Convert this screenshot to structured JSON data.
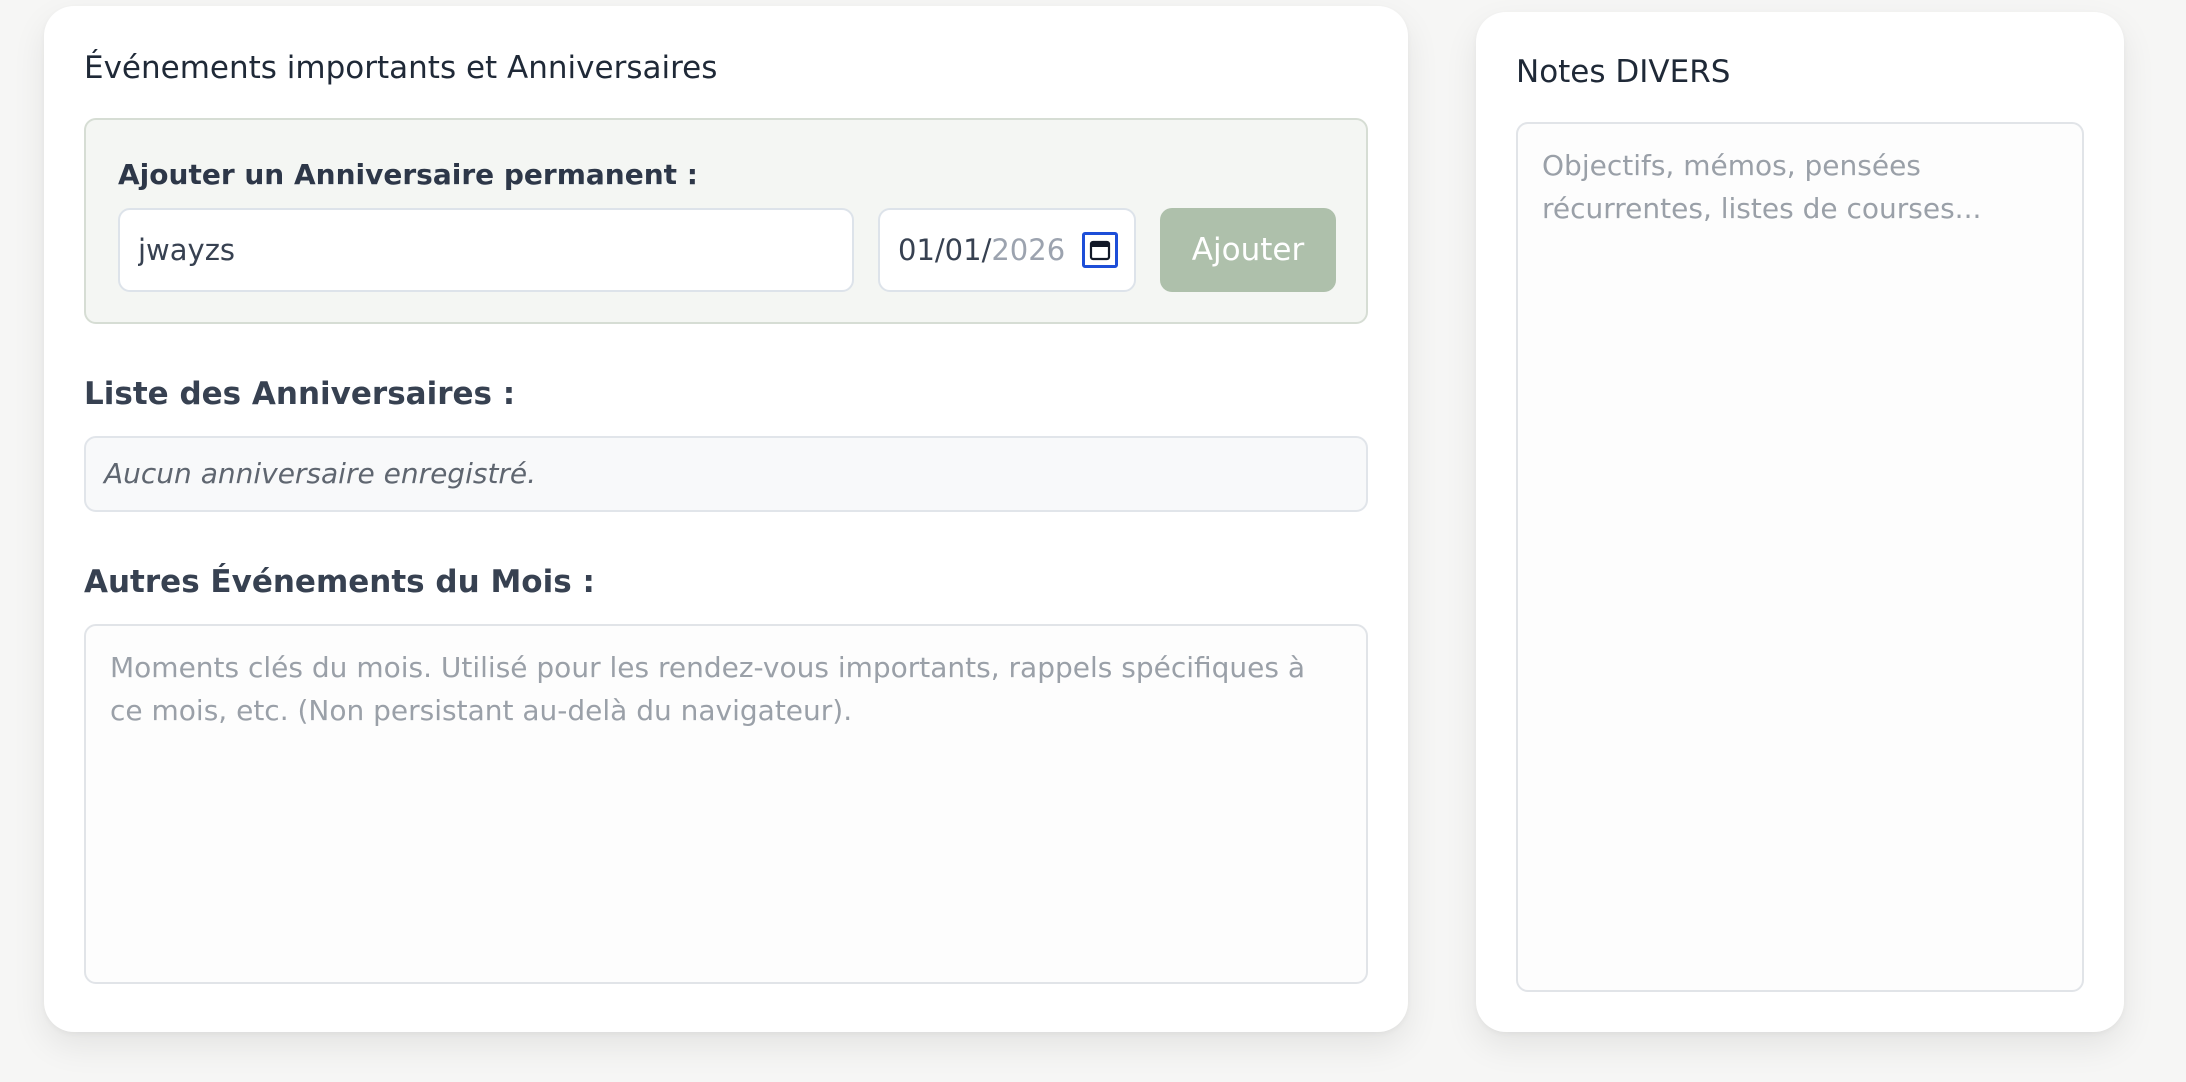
{
  "events_card": {
    "title": "Événements importants et Anniversaires",
    "add_section": {
      "label": "Ajouter un Anniversaire permanent :",
      "name_value": "jwayzs",
      "date_day_month": "01/01/",
      "date_year": "2026",
      "add_button_label": "Ajouter"
    },
    "list_heading": "Liste des Anniversaires :",
    "list_empty_text": "Aucun anniversaire enregistré.",
    "other_events_heading": "Autres Événements du Mois :",
    "other_events_placeholder": "Moments clés du mois. Utilisé pour les rendez-vous importants, rappels spécifiques à ce mois, etc. (Non persistant au-delà du navigateur)."
  },
  "notes_card": {
    "title": "Notes DIVERS",
    "placeholder": "Objectifs, mémos, pensées récurrentes, listes de courses..."
  },
  "icons": {
    "date_picker": "calendar-icon"
  },
  "colors": {
    "add_button_bg": "#aec0ab",
    "add_box_bg": "#f4f6f3",
    "focus_ring": "#1d4ed8"
  }
}
